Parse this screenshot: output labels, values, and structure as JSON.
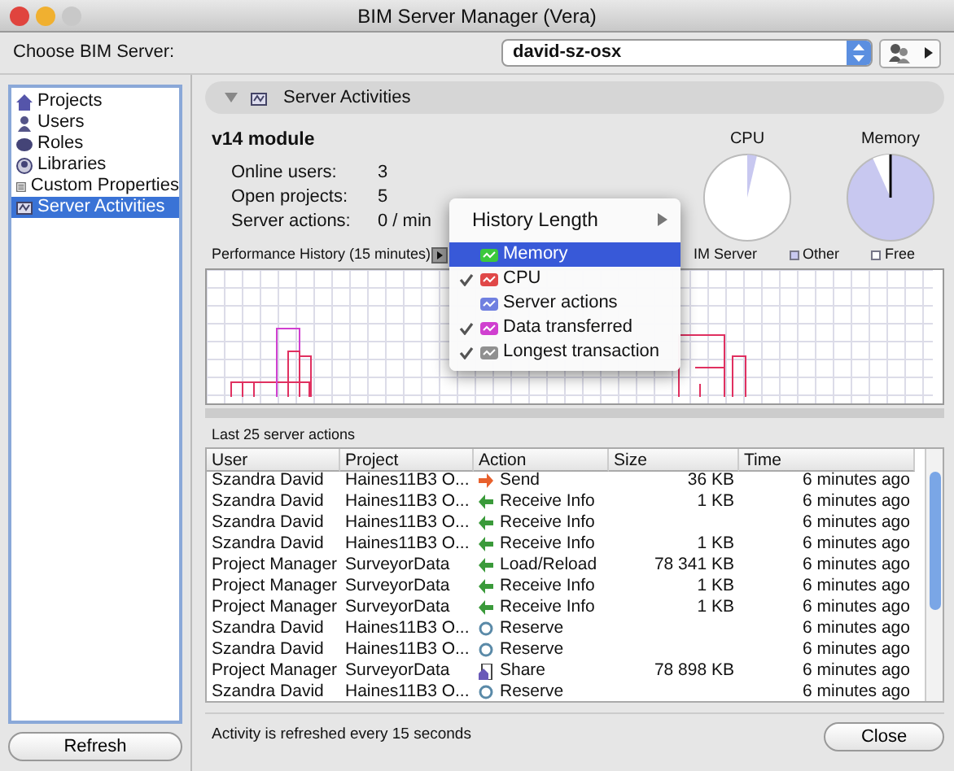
{
  "window": {
    "title": "BIM Server Manager (Vera)"
  },
  "server_chooser": {
    "label": "Choose BIM Server:",
    "value": "david-sz-osx"
  },
  "sidebar": {
    "items": [
      {
        "label": "Projects",
        "kind": "house",
        "selected": false
      },
      {
        "label": "Users",
        "kind": "person",
        "selected": false
      },
      {
        "label": "Roles",
        "kind": "roles",
        "selected": false
      },
      {
        "label": "Libraries",
        "kind": "library",
        "selected": false
      },
      {
        "label": "Custom Properties",
        "kind": "properties",
        "selected": false
      },
      {
        "label": "Server Activities",
        "kind": "activity",
        "selected": true
      }
    ]
  },
  "refresh_button": "Refresh",
  "panel": {
    "title": "Server Activities",
    "expanded": true
  },
  "module": {
    "title": "v14 module",
    "stats": [
      {
        "label": "Online users:",
        "value": "3"
      },
      {
        "label": "Open projects:",
        "value": "5"
      },
      {
        "label": "Server actions:",
        "value": "0 / min"
      }
    ]
  },
  "pies": [
    {
      "title": "CPU"
    },
    {
      "title": "Memory"
    }
  ],
  "pie_legend": [
    {
      "label": "IM Server"
    },
    {
      "label": "Other",
      "color": "#c8c8f0"
    },
    {
      "label": "Free",
      "color": "#ffffff"
    }
  ],
  "performance": {
    "label": "Performance History (15 minutes)"
  },
  "history_menu": {
    "items": [
      {
        "label": "History Length",
        "kind": "submenu"
      },
      {
        "label": "Memory",
        "kind": "series",
        "checked": false,
        "selected": true,
        "color": "#3cc83c"
      },
      {
        "label": "CPU",
        "kind": "series",
        "checked": true,
        "selected": false,
        "color": "#e04848"
      },
      {
        "label": "Server actions",
        "kind": "series",
        "checked": false,
        "selected": false,
        "color": "#7080e0"
      },
      {
        "label": "Data transferred",
        "kind": "series",
        "checked": true,
        "selected": false,
        "color": "#d040d0"
      },
      {
        "label": "Longest transaction",
        "kind": "series",
        "checked": true,
        "selected": false,
        "color": "#909090"
      }
    ]
  },
  "actions": {
    "label": "Last 25 server actions",
    "columns": [
      "User",
      "Project",
      "Action",
      "Size",
      "Time"
    ],
    "rows": [
      {
        "user": "Szandra David",
        "project": "Haines11B3 O...",
        "action": "Send",
        "kind": "send",
        "size": "36 KB",
        "time": "6 minutes ago"
      },
      {
        "user": "Szandra David",
        "project": "Haines11B3 O...",
        "action": "Receive Info",
        "kind": "receive",
        "size": "1 KB",
        "time": "6 minutes ago"
      },
      {
        "user": "Szandra David",
        "project": "Haines11B3 O...",
        "action": "Receive Info",
        "kind": "receive",
        "time": "6 minutes ago"
      },
      {
        "user": "Szandra David",
        "project": "Haines11B3 O...",
        "action": "Receive Info",
        "kind": "receive",
        "size": "1 KB",
        "time": "6 minutes ago"
      },
      {
        "user": "Project Manager",
        "project": "SurveyorData",
        "action": "Load/Reload",
        "kind": "receive",
        "size": "78 341 KB",
        "time": "6 minutes ago"
      },
      {
        "user": "Project Manager",
        "project": "SurveyorData",
        "action": "Receive Info",
        "kind": "receive",
        "size": "1 KB",
        "time": "6 minutes ago"
      },
      {
        "user": "Project Manager",
        "project": "SurveyorData",
        "action": "Receive Info",
        "kind": "receive",
        "size": "1 KB",
        "time": "6 minutes ago"
      },
      {
        "user": "Szandra David",
        "project": "Haines11B3 O...",
        "action": "Reserve",
        "kind": "reserve",
        "time": "6 minutes ago"
      },
      {
        "user": "Szandra David",
        "project": "Haines11B3 O...",
        "action": "Reserve",
        "kind": "reserve",
        "time": "6 minutes ago"
      },
      {
        "user": "Project Manager",
        "project": "SurveyorData",
        "action": "Share",
        "kind": "share",
        "size": "78 898 KB",
        "time": "6 minutes ago"
      },
      {
        "user": "Szandra David",
        "project": "Haines11B3 O...",
        "action": "Reserve",
        "kind": "reserve",
        "time": "6 minutes ago"
      }
    ]
  },
  "status": "Activity is refreshed every 15 seconds",
  "close_button": "Close"
}
